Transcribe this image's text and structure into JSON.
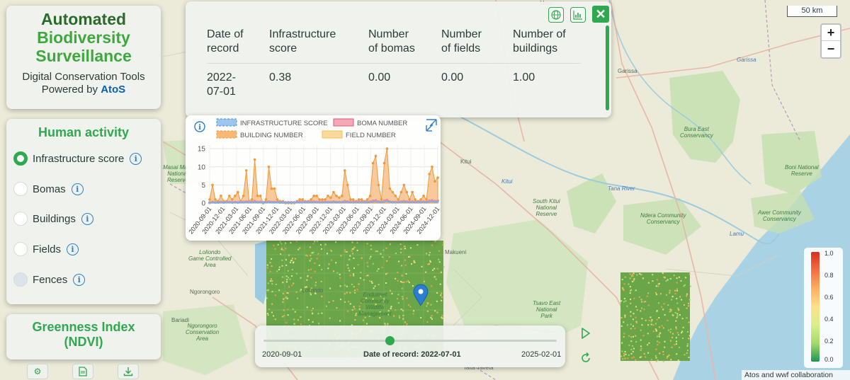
{
  "brand": {
    "title_line1": "Automated",
    "title_line2": "Biodiversity",
    "title_line3": "Surveillance",
    "subtitle": "Digital Conservation Tools",
    "powered_by": "Powered by",
    "powered_brand": "AtoS"
  },
  "human_activity": {
    "heading": "Human activity",
    "options": [
      {
        "label": "Infrastructure score",
        "selected": true
      },
      {
        "label": "Bomas",
        "selected": false
      },
      {
        "label": "Buildings",
        "selected": false
      },
      {
        "label": "Fields",
        "selected": false
      },
      {
        "label": "Fences",
        "selected": false,
        "disabled": true
      }
    ]
  },
  "ndvi": {
    "heading_line1": "Greenness Index",
    "heading_line2": "(NDVI)"
  },
  "footer_buttons": [
    "gear-icon",
    "pdf-icon",
    "download-icon"
  ],
  "record_table": {
    "headers": [
      "Date of record",
      "Infrastructure score",
      "Number of bomas",
      "Number of fields",
      "Number of buildings"
    ],
    "header_lines": [
      [
        "Date of",
        "record"
      ],
      [
        "Infrastructure",
        "score"
      ],
      [
        "Number",
        "of bomas"
      ],
      [
        "Number",
        "of fields"
      ],
      [
        "Number of",
        "buildings"
      ]
    ],
    "row": {
      "date_line1": "2022-",
      "date_line2": "07-01",
      "infrastructure_score": "0.38",
      "bomas": "0.00",
      "fields": "0.00",
      "buildings": "1.00"
    }
  },
  "chart_data": {
    "type": "area",
    "legend": [
      {
        "name": "INFRASTRUCTURE SCORE",
        "color": "#9ec5eb",
        "stroke": "#4a90d9"
      },
      {
        "name": "BOMA NUMBER",
        "color": "#f4a8b8",
        "stroke": "#e05a7a"
      },
      {
        "name": "BUILDING NUMBER",
        "color": "#f7b974",
        "stroke": "#f09a3a"
      },
      {
        "name": "FIELD NUMBER",
        "color": "#fbd99a",
        "stroke": "#f2c15a"
      }
    ],
    "y_ticks": [
      "0",
      "5",
      "10",
      "15"
    ],
    "ylim": [
      0,
      16
    ],
    "x_tick_labels": [
      "2020-09-01",
      "2020-12-01",
      "2021-03-01",
      "2021-06-01",
      "2021-09-01",
      "2021-12-01",
      "2022-03-01",
      "2022-06-01",
      "2022-09-01",
      "2022-12-01",
      "2023-03-01",
      "2023-06-01",
      "2023-09-01",
      "2023-12-01",
      "2024-03-01",
      "2024-06-01",
      "2024-09-01",
      "2024-12-01"
    ],
    "building_values": [
      1,
      5,
      1,
      0.5,
      2,
      0.5,
      0.5,
      2,
      1,
      2,
      3,
      0.5,
      2,
      9,
      0.5,
      1,
      12,
      2,
      2,
      0,
      1,
      10,
      4,
      4,
      1,
      0.5,
      0.5,
      0,
      0,
      0,
      0,
      0.5,
      1,
      1,
      0.5,
      0.5,
      1,
      2,
      2,
      1,
      1,
      1,
      2,
      1.5,
      3,
      2,
      1.5,
      2,
      9,
      5,
      1,
      1,
      0.5,
      1,
      1,
      0.5,
      1,
      2,
      11,
      13,
      5,
      1,
      11,
      15,
      4,
      3,
      2,
      1,
      3,
      5,
      3,
      1,
      3,
      1,
      0.5,
      1,
      2,
      1,
      8,
      10,
      6,
      7
    ],
    "boma_values": [
      0.1,
      0.3,
      0.2,
      0.2,
      0.3,
      0.2,
      0.3,
      0.3,
      0.2,
      0.3,
      0.2,
      0.3,
      0.3,
      0.4,
      0.3,
      0.3,
      0.5,
      0.3,
      0.3,
      0.2,
      0.3,
      0.4,
      0.3,
      0.3,
      0.3,
      0.2,
      0.2,
      0.2,
      0.2,
      0.2,
      0.2,
      0.3,
      0.3,
      0.3,
      0.3,
      0.3,
      0.3,
      0.4,
      0.3,
      0.3,
      0.3,
      0.3,
      0.3,
      0.3,
      0.4,
      0.3,
      0.3,
      0.3,
      0.5,
      0.4,
      0.3,
      0.3,
      0.3,
      0.3,
      0.3,
      0.3,
      0.3,
      0.4,
      0.6,
      0.7,
      0.4,
      0.3,
      0.6,
      0.8,
      0.4,
      0.3,
      0.3,
      0.3,
      0.4,
      0.5,
      0.4,
      0.3,
      0.4,
      0.3,
      0.3,
      0.3,
      0.4,
      0.3,
      0.6,
      0.7,
      0.5,
      0.6
    ]
  },
  "timeline": {
    "start": "2020-09-01",
    "current_label": "Date of record: 2022-07-01",
    "end": "2025-02-01",
    "position_fraction": 0.43
  },
  "map": {
    "scale_label": "50 km",
    "zoom_in": "+",
    "zoom_out": "−",
    "attribution": "Atos and wwf collaboration",
    "legend_ticks": [
      "1.0",
      "0.8",
      "0.6",
      "0.4",
      "0.2",
      "0.0"
    ],
    "place_labels": [
      {
        "text": "Garissa",
        "kind": "town"
      },
      {
        "text": "Garissa",
        "kind": "blue"
      },
      {
        "text": "Bura East\nConservancy",
        "kind": "green"
      },
      {
        "text": "Boni National\nReserve",
        "kind": "green"
      },
      {
        "text": "Tana River",
        "kind": "blue"
      },
      {
        "text": "South Kitui\nNational\nReserve",
        "kind": "green"
      },
      {
        "text": "Ndera Community\nConservancy",
        "kind": "green"
      },
      {
        "text": "Awer Community\nConservancy",
        "kind": "green"
      },
      {
        "text": "Lamu",
        "kind": "blue"
      },
      {
        "text": "Kitui",
        "kind": "town"
      },
      {
        "text": "Kitui",
        "kind": "blue"
      },
      {
        "text": "Makueni",
        "kind": "town"
      },
      {
        "text": "Tsavo East\nNational\nPark",
        "kind": "green"
      },
      {
        "text": "Loliondo\nGame Controlled\nArea",
        "kind": "green"
      },
      {
        "text": "Ngorongoro",
        "kind": "town"
      },
      {
        "text": "Ngorongoro\nConservation\nArea",
        "kind": "green"
      },
      {
        "text": "Loliondo",
        "kind": "town"
      },
      {
        "text": "Enduimet\nCommunity\nWildlife\nManagement",
        "kind": "green"
      },
      {
        "text": "Masai Mara\nNational\nReserve",
        "kind": "green"
      },
      {
        "text": "Bariadi",
        "kind": "town"
      },
      {
        "text": "Taita Taveta",
        "kind": "town"
      },
      {
        "text": "Meru",
        "kind": "town"
      }
    ]
  }
}
